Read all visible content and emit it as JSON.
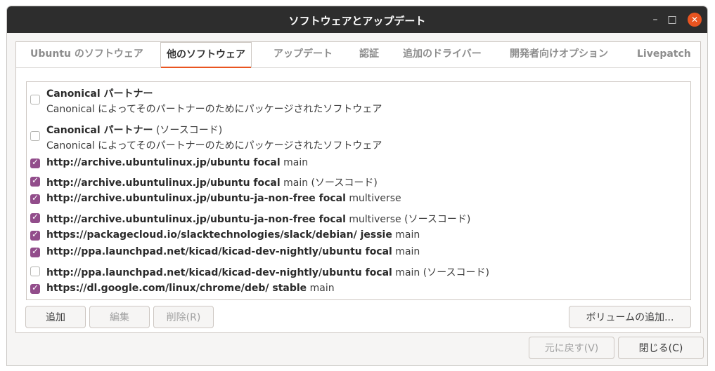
{
  "window": {
    "title": "ソフトウェアとアップデート",
    "controls": {
      "minimize": "–",
      "maximize": "□",
      "close": "✕"
    }
  },
  "tabs": [
    {
      "label": "Ubuntu のソフトウェア",
      "active": false
    },
    {
      "label": "他のソフトウェア",
      "active": true
    },
    {
      "label": "アップデート",
      "active": false
    },
    {
      "label": "認証",
      "active": false
    },
    {
      "label": "追加のドライバー",
      "active": false
    },
    {
      "label": "開発者向けオプション",
      "active": false
    },
    {
      "label": "Livepatch",
      "active": false
    }
  ],
  "sources": [
    {
      "bold": "Canonical パートナー",
      "rest": "",
      "sub": "Canonical によってそのパートナーのためにパッケージされたソフトウェア",
      "checked": false
    },
    {
      "bold": "Canonical パートナー",
      "rest": " (ソースコード)",
      "sub": "Canonical によってそのパートナーのためにパッケージされたソフトウェア",
      "checked": false
    },
    {
      "bold": "http://archive.ubuntulinux.jp/ubuntu focal",
      "rest": " main",
      "checked": true
    },
    {
      "bold": "http://archive.ubuntulinux.jp/ubuntu focal",
      "rest": " main (ソースコード)",
      "checked": true
    },
    {
      "bold": "http://archive.ubuntulinux.jp/ubuntu-ja-non-free focal",
      "rest": " multiverse",
      "checked": true
    },
    {
      "bold": "http://archive.ubuntulinux.jp/ubuntu-ja-non-free focal",
      "rest": " multiverse (ソースコード)",
      "checked": true
    },
    {
      "bold": "https://packagecloud.io/slacktechnologies/slack/debian/ jessie",
      "rest": " main",
      "checked": true
    },
    {
      "bold": "http://ppa.launchpad.net/kicad/kicad-dev-nightly/ubuntu focal",
      "rest": " main",
      "checked": true
    },
    {
      "bold": "http://ppa.launchpad.net/kicad/kicad-dev-nightly/ubuntu focal",
      "rest": " main (ソースコード)",
      "checked": false
    },
    {
      "bold": "https://dl.google.com/linux/chrome/deb/ stable",
      "rest": " main",
      "checked": true
    }
  ],
  "buttons": {
    "add": "追加",
    "edit": "編集",
    "remove": "削除(R)",
    "add_volume": "ボリュームの追加...",
    "revert": "元に戻す(V)",
    "close": "閉じる(C)"
  }
}
